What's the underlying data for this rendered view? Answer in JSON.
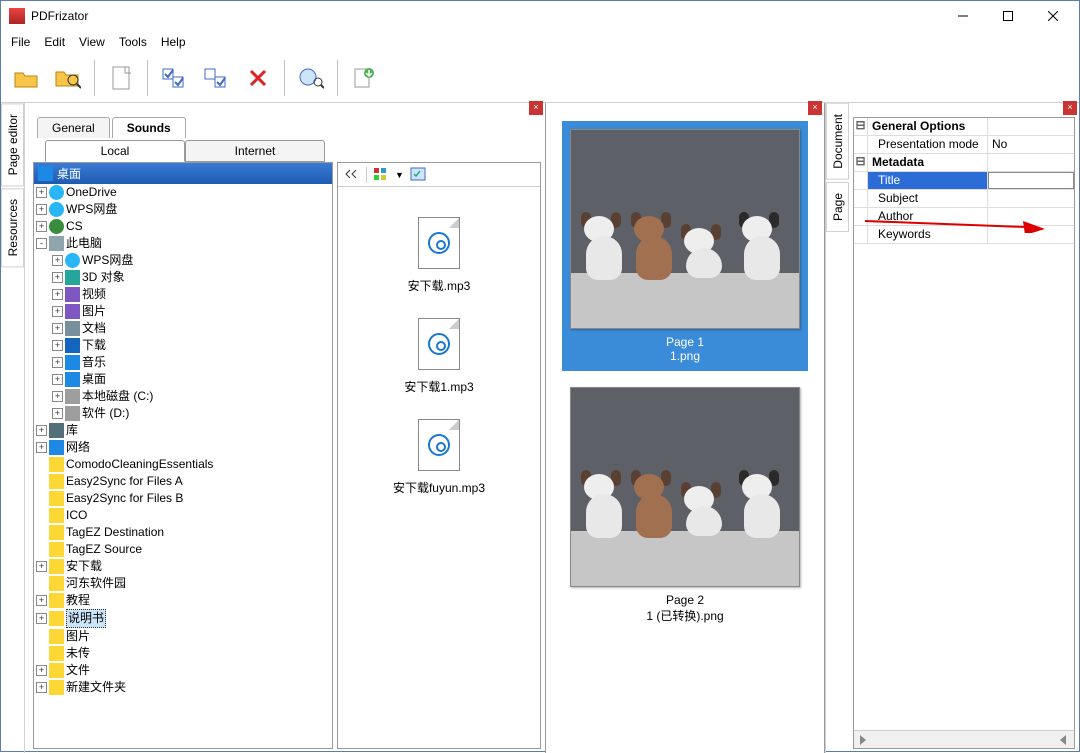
{
  "window": {
    "title": "PDFrizator"
  },
  "menu": [
    "File",
    "Edit",
    "View",
    "Tools",
    "Help"
  ],
  "toolbar": [
    "open-folder",
    "open-search",
    "new-page",
    "check1",
    "check2",
    "delete",
    "transition-preview",
    "zoom-search",
    "pdf-export"
  ],
  "side_left": [
    "Page editor",
    "Resources"
  ],
  "side_right": [
    "Document",
    "Page"
  ],
  "left_tabs": {
    "general": "General",
    "sounds": "Sounds"
  },
  "local_tabs": {
    "local": "Local",
    "internet": "Internet"
  },
  "tree": {
    "root": "桌面",
    "nodes": [
      {
        "exp": "+",
        "icon": "cloud",
        "label": "OneDrive"
      },
      {
        "exp": "+",
        "icon": "cloud",
        "label": "WPS网盘"
      },
      {
        "exp": "+",
        "icon": "user",
        "label": "CS"
      },
      {
        "exp": "-",
        "icon": "pc",
        "label": "此电脑",
        "children": [
          {
            "exp": "+",
            "icon": "cloud",
            "label": "WPS网盘"
          },
          {
            "exp": "+",
            "icon": "3d",
            "label": "3D 对象"
          },
          {
            "exp": "+",
            "icon": "video",
            "label": "视频"
          },
          {
            "exp": "+",
            "icon": "pictures",
            "label": "图片"
          },
          {
            "exp": "+",
            "icon": "docs",
            "label": "文档"
          },
          {
            "exp": "+",
            "icon": "downloads",
            "label": "下载"
          },
          {
            "exp": "+",
            "icon": "music",
            "label": "音乐"
          },
          {
            "exp": "+",
            "icon": "desktop",
            "label": "桌面"
          },
          {
            "exp": "+",
            "icon": "disk",
            "label": "本地磁盘 (C:)"
          },
          {
            "exp": "+",
            "icon": "disk",
            "label": "软件 (D:)"
          }
        ]
      },
      {
        "exp": "+",
        "icon": "lib",
        "label": "库"
      },
      {
        "exp": "+",
        "icon": "net",
        "label": "网络"
      },
      {
        "exp": "",
        "icon": "folder",
        "label": "ComodoCleaningEssentials"
      },
      {
        "exp": "",
        "icon": "folder",
        "label": "Easy2Sync for Files A"
      },
      {
        "exp": "",
        "icon": "folder",
        "label": "Easy2Sync for Files B"
      },
      {
        "exp": "",
        "icon": "folder",
        "label": "ICO"
      },
      {
        "exp": "",
        "icon": "folder",
        "label": "TagEZ Destination"
      },
      {
        "exp": "",
        "icon": "folder",
        "label": "TagEZ Source"
      },
      {
        "exp": "+",
        "icon": "folder",
        "label": "安下载"
      },
      {
        "exp": "",
        "icon": "folder",
        "label": "河东软件园"
      },
      {
        "exp": "+",
        "icon": "folder",
        "label": "教程"
      },
      {
        "exp": "+",
        "icon": "folder",
        "label": "说明书",
        "selected": true
      },
      {
        "exp": "",
        "icon": "folder",
        "label": "图片"
      },
      {
        "exp": "",
        "icon": "folder",
        "label": "未传"
      },
      {
        "exp": "+",
        "icon": "folder",
        "label": "文件"
      },
      {
        "exp": "+",
        "icon": "folder",
        "label": "新建文件夹"
      }
    ]
  },
  "files": [
    "安下载.mp3",
    "安下载1.mp3",
    "安下载fuyun.mp3"
  ],
  "pages": [
    {
      "caption_top": "Page 1",
      "caption_bottom": "1.png",
      "selected": true
    },
    {
      "caption_top": "Page 2",
      "caption_bottom": "1 (已转换).png",
      "selected": false
    }
  ],
  "props": {
    "group1": "General Options",
    "presentation_mode_k": "Presentation mode",
    "presentation_mode_v": "No",
    "group2": "Metadata",
    "title_k": "Title",
    "title_v": "",
    "subject_k": "Subject",
    "subject_v": "",
    "author_k": "Author",
    "author_v": "",
    "keywords_k": "Keywords",
    "keywords_v": ""
  }
}
